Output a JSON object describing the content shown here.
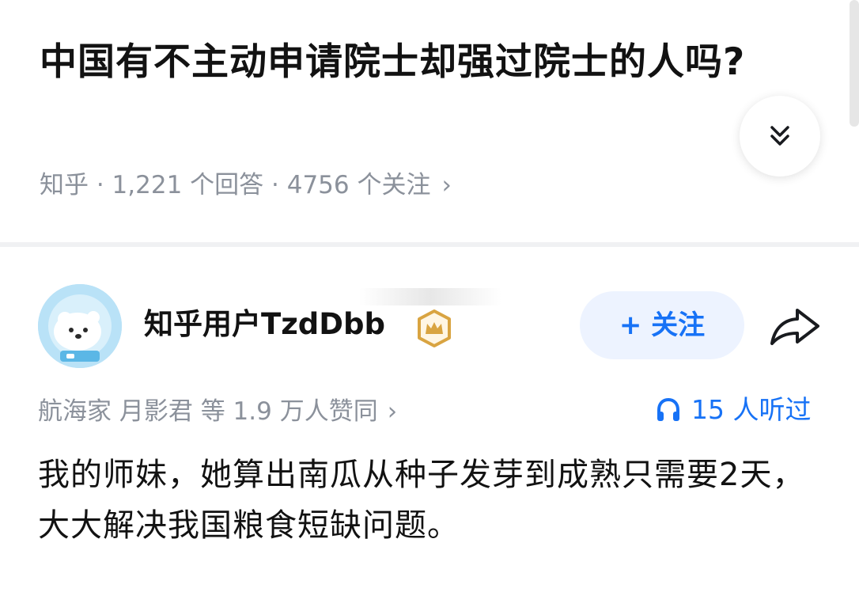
{
  "question": {
    "title": "中国有不主动申请院士却强过院士的人吗?",
    "meta": "知乎 · 1,221 个回答 · 4756 个关注",
    "meta_chevron": "›"
  },
  "answer": {
    "author_name": "知乎用户TzdDbb",
    "follow_label": "+ 关注",
    "voters": "航海家 月影君 等 1.9 万人赞同",
    "voters_chevron": "›",
    "listen_count": "15 人听过",
    "content": "我的师妹，她算出南瓜从种子发芽到成熟只需要2天，大大解决我国粮食短缺问题。"
  },
  "icons": {
    "expand": "double-chevron-down-icon",
    "share": "share-arrow-icon",
    "badge": "crown-badge-icon",
    "listen": "headphones-icon"
  },
  "colors": {
    "accent": "#1772f6",
    "follow_bg": "#edf3ff",
    "muted_text": "#8b919b",
    "badge": "#d9a441"
  }
}
